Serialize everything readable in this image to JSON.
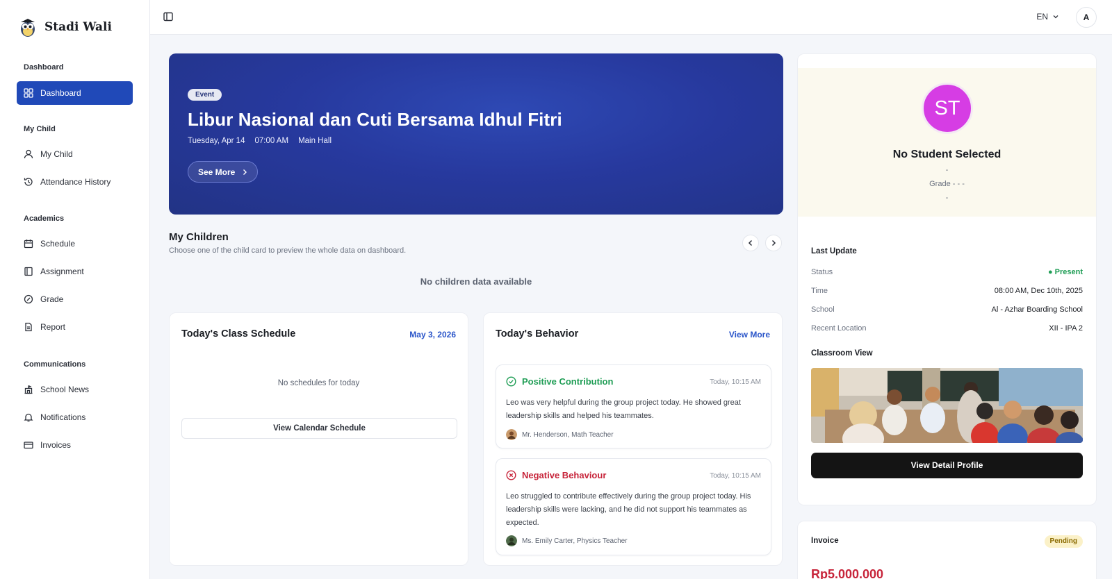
{
  "brand": {
    "name": "Stadi Wali"
  },
  "sidebar": {
    "sections": [
      {
        "title": "Dashboard",
        "items": [
          {
            "label": "Dashboard",
            "icon": "grid-icon",
            "active": true
          }
        ]
      },
      {
        "title": "My Child",
        "items": [
          {
            "label": "My Child",
            "icon": "user-icon"
          },
          {
            "label": "Attendance History",
            "icon": "history-icon"
          }
        ]
      },
      {
        "title": "Academics",
        "items": [
          {
            "label": "Schedule",
            "icon": "calendar-icon"
          },
          {
            "label": "Assignment",
            "icon": "book-icon"
          },
          {
            "label": "Grade",
            "icon": "grade-icon"
          },
          {
            "label": "Report",
            "icon": "report-icon"
          }
        ]
      },
      {
        "title": "Communications",
        "items": [
          {
            "label": "School News",
            "icon": "school-icon"
          },
          {
            "label": "Notifications",
            "icon": "bell-icon"
          },
          {
            "label": "Invoices",
            "icon": "card-icon"
          }
        ]
      }
    ]
  },
  "topbar": {
    "language": "EN",
    "avatar_initial": "A"
  },
  "banner": {
    "tag": "Event",
    "title": "Libur Nasional dan Cuti Bersama Idhul Fitri",
    "date": "Tuesday, Apr 14",
    "time": "07:00 AM",
    "location": "Main Hall",
    "button": "See More"
  },
  "my_children": {
    "title": "My Children",
    "subtitle": "Choose one of the child card to preview the whole data on dashboard.",
    "empty": "No children data available"
  },
  "schedule": {
    "title": "Today's Class Schedule",
    "date": "May 3, 2026",
    "empty": "No schedules for today",
    "button": "View Calendar Schedule"
  },
  "behavior": {
    "title": "Today's Behavior",
    "link": "View More",
    "items": [
      {
        "type": "Positive Contribution",
        "time": "Today, 10:15 AM",
        "text": "Leo was very helpful during the group project today. He showed great leadership skills and helped his teammates.",
        "author": "Mr. Henderson, Math Teacher"
      },
      {
        "type": "Negative Behaviour",
        "time": "Today, 10:15 AM",
        "text": "Leo struggled to contribute effectively during the group project today. His leadership skills were lacking, and he did not support his teammates as expected.",
        "author": "Ms. Emily Carter, Physics Teacher"
      }
    ]
  },
  "profile": {
    "initials": "ST",
    "name": "No Student Selected",
    "line1": "-",
    "grade": "Grade - - -",
    "line3": "-",
    "last_update_title": "Last Update",
    "rows": [
      {
        "key": "Status",
        "value": "Present"
      },
      {
        "key": "Time",
        "value": "08:00 AM, Dec 10th, 2025"
      },
      {
        "key": "School",
        "value": "Al - Azhar Boarding School"
      },
      {
        "key": "Recent Location",
        "value": "XII - IPA 2"
      }
    ],
    "classroom_title": "Classroom View",
    "button": "View Detail Profile"
  },
  "invoice": {
    "title": "Invoice",
    "status": "Pending",
    "amount": "Rp5.000.000"
  },
  "colors": {
    "primary": "#2049b8",
    "banner": "#27399e",
    "avatar": "#d63de4",
    "positive": "#1f9d55",
    "negative": "#c7243a"
  }
}
